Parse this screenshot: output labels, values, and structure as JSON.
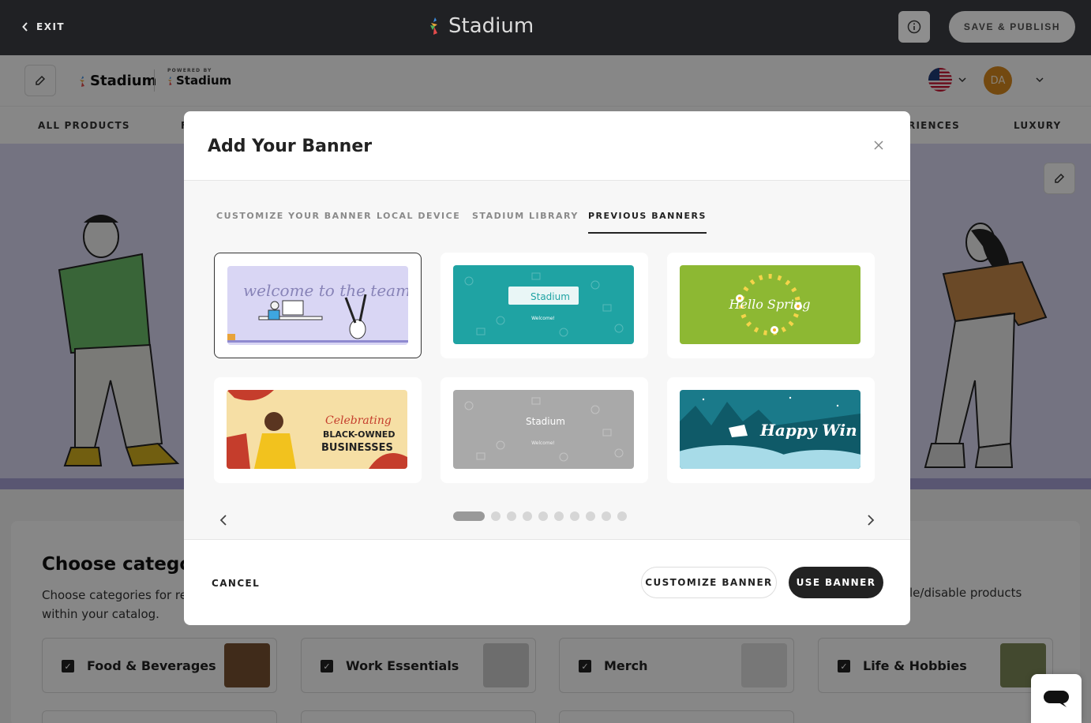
{
  "topbar": {
    "exit_label": "EXIT",
    "brand": "Stadium",
    "publish_label": "SAVE & PUBLISH"
  },
  "store": {
    "logo_text": "Stadium",
    "powered_by": "POWERED BY",
    "powered_name": "Stadium",
    "avatar_initials": "DA",
    "nav": [
      "ALL PRODUCTS",
      "F",
      "RIENCES",
      "LUXURY"
    ]
  },
  "categories": {
    "title": "Choose categori",
    "desc_line1": "Choose categories for re",
    "desc_line2": "within your catalog.",
    "desc_right": "le/disable products",
    "items": [
      {
        "label": "Food & Beverages"
      },
      {
        "label": "Work Essentials"
      },
      {
        "label": "Merch"
      },
      {
        "label": "Life & Hobbies"
      }
    ]
  },
  "modal": {
    "title": "Add Your Banner",
    "tabs": [
      {
        "label": "CUSTOMIZE YOUR BANNER",
        "active": false
      },
      {
        "label": "LOCAL DEVICE",
        "active": false
      },
      {
        "label": "STADIUM LIBRARY",
        "active": false
      },
      {
        "label": "PREVIOUS BANNERS",
        "active": true
      }
    ],
    "banners": [
      {
        "text": "welcome to the team!",
        "bg": "#d9d6f4",
        "selected": true
      },
      {
        "text": "Stadium",
        "subtext": "Welcome!",
        "bg": "#1fa3a3"
      },
      {
        "text": "Hello Spring",
        "bg": "#8db833"
      },
      {
        "text": "Celebrating",
        "text2": "BLACK-OWNED",
        "text3": "BUSINESSES",
        "bg": "#f6dfa5"
      },
      {
        "text": "Stadium",
        "subtext": "Welcome!",
        "bg": "#a9a9a9"
      },
      {
        "text": "Happy Win",
        "bg": "#1a7a8a"
      }
    ],
    "pagination": {
      "total": 10,
      "current": 1
    },
    "cancel_label": "CANCEL",
    "customize_label": "CUSTOMIZE BANNER",
    "use_label": "USE BANNER"
  },
  "colors": {
    "topbar": "#202124",
    "primary_button": "#222222",
    "overlay": "rgba(0,0,0,0.47)"
  }
}
